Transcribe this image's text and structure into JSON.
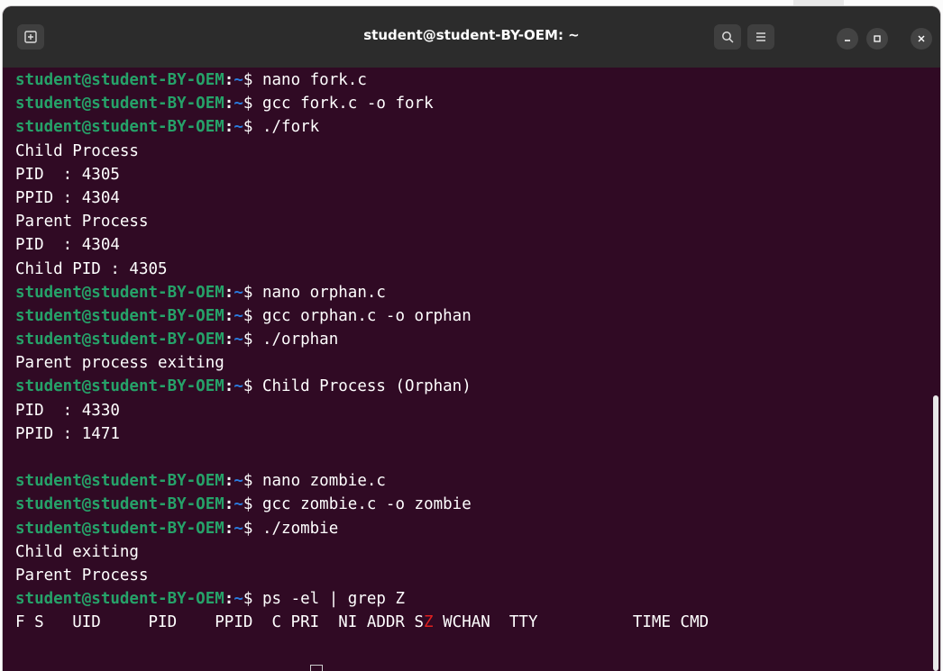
{
  "window": {
    "title": "student@student-BY-OEM: ~"
  },
  "prompt": {
    "user_host": "student@student-BY-OEM",
    "separator": ":",
    "path": "~",
    "symbol": "$ "
  },
  "lines": [
    {
      "kind": "prompt",
      "cmd": "nano fork.c"
    },
    {
      "kind": "prompt",
      "cmd": "gcc fork.c -o fork"
    },
    {
      "kind": "prompt",
      "cmd": "./fork"
    },
    {
      "kind": "out",
      "text": "Child Process"
    },
    {
      "kind": "out",
      "text": "PID  : 4305"
    },
    {
      "kind": "out",
      "text": "PPID : 4304"
    },
    {
      "kind": "out",
      "text": "Parent Process"
    },
    {
      "kind": "out",
      "text": "PID  : 4304"
    },
    {
      "kind": "out",
      "text": "Child PID : 4305"
    },
    {
      "kind": "prompt",
      "cmd": "nano orphan.c"
    },
    {
      "kind": "prompt",
      "cmd": "gcc orphan.c -o orphan"
    },
    {
      "kind": "prompt",
      "cmd": "./orphan"
    },
    {
      "kind": "out",
      "text": "Parent process exiting"
    },
    {
      "kind": "prompt",
      "cmd": "Child Process (Orphan)"
    },
    {
      "kind": "out",
      "text": "PID  : 4330"
    },
    {
      "kind": "out",
      "text": "PPID : 1471"
    },
    {
      "kind": "out",
      "text": ""
    },
    {
      "kind": "prompt",
      "cmd": "nano zombie.c"
    },
    {
      "kind": "prompt",
      "cmd": "gcc zombie.c -o zombie"
    },
    {
      "kind": "prompt",
      "cmd": "./zombie"
    },
    {
      "kind": "out",
      "text": "Child exiting"
    },
    {
      "kind": "out",
      "text": "Parent Process"
    },
    {
      "kind": "prompt",
      "cmd": "ps -el | grep Z"
    }
  ],
  "header_row": {
    "before": "F S   UID     PID    PPID  C PRI  NI ADDR S",
    "highlight": "Z",
    "after": " WCHAN  TTY          TIME CMD"
  },
  "colors": {
    "background": "#300a24",
    "titlebar": "#2c2c2c",
    "user_host": "#26a269",
    "path": "#2a7bde",
    "highlight": "#e02020"
  },
  "icons": {
    "new_tab": "new-tab-icon",
    "search": "search-icon",
    "menu": "hamburger-menu-icon",
    "minimize": "minimize-icon",
    "maximize": "maximize-icon",
    "close": "close-icon"
  }
}
